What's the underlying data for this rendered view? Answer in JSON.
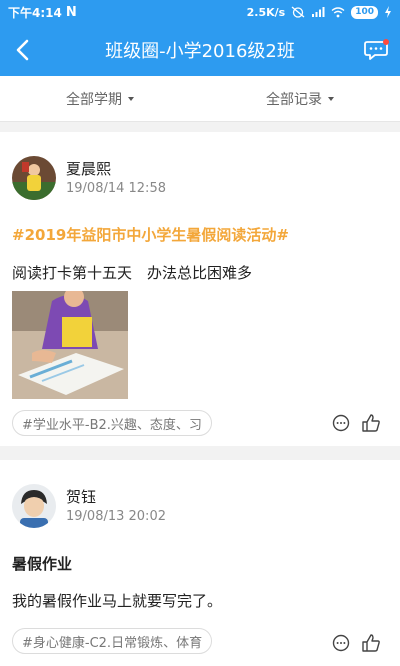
{
  "status_bar": {
    "time": "下午4:14",
    "notification_glyph": "N",
    "net_speed": "2.5K/s",
    "battery": "100"
  },
  "titlebar": {
    "title": "班级圈-小学2016级2班"
  },
  "filters": {
    "semester": "全部学期",
    "records": "全部记录"
  },
  "posts": [
    {
      "author": "夏晨熙",
      "time": "19/08/14 12:58",
      "topic": "#2019年益阳市中小学生暑假阅读活动#",
      "text": "阅读打卡第十五天　办法总比困难多",
      "tag": "#学业水平-B2.兴趣、态度、习"
    },
    {
      "author": "贺钰",
      "time": "19/08/13 20:02",
      "heading": "暑假作业",
      "text": "我的暑假作业马上就要写完了。",
      "tag": "#身心健康-C2.日常锻炼、体育"
    }
  ],
  "icons": {
    "back": "back-arrow-icon",
    "message": "chat-bubble-icon",
    "comment": "comment-icon",
    "like": "thumbs-up-icon"
  },
  "colors": {
    "primary": "#2d9bf0",
    "topic": "#f3a73a"
  }
}
